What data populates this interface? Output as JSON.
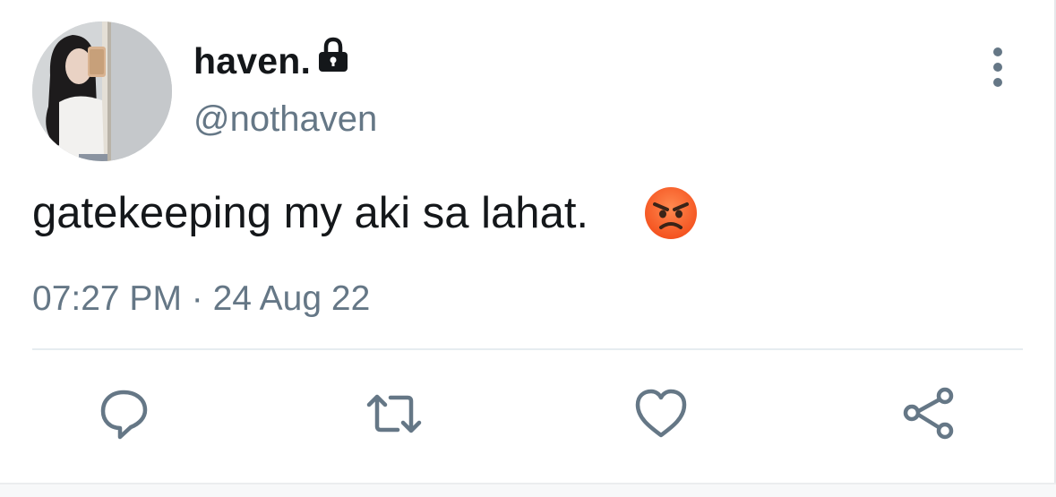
{
  "author": {
    "display_name": "haven.",
    "handle": "@nothaven",
    "protected_icon": "lock-icon",
    "avatar_icon": "profile-photo"
  },
  "tweet": {
    "text": "gatekeeping my aki sa lahat.",
    "emoji": "angry-face-emoji",
    "timestamp": "07:27 PM · 24 Aug 22"
  },
  "menu_icon": "more-vertical-icon",
  "actions": [
    {
      "name": "reply",
      "icon": "reply-icon"
    },
    {
      "name": "retweet",
      "icon": "retweet-icon"
    },
    {
      "name": "like",
      "icon": "heart-icon"
    },
    {
      "name": "share",
      "icon": "share-icon"
    }
  ],
  "colors": {
    "text_primary": "#14171a",
    "text_secondary": "#657786",
    "icon_gray": "#657786",
    "divider": "#e6ecf0",
    "emoji_face": "#f4511e"
  }
}
